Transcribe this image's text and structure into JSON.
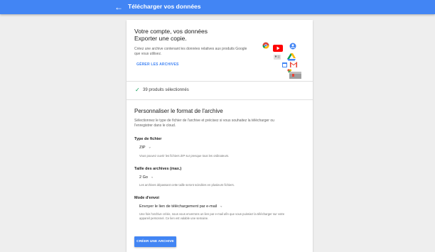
{
  "header": {
    "title": "Télécharger vos données",
    "back_icon": "arrow-back-icon"
  },
  "intro": {
    "heading_line1": "Votre compte, vos données",
    "heading_line2": "Exporter une copie.",
    "description": "Créez une archive contenant les données relatives aux produits Google que vous utilisez.",
    "manage_link": "GÉRER LES ARCHIVES"
  },
  "products": {
    "selected_text": "39 produits sélectionnés",
    "icon": "check-icon"
  },
  "customize": {
    "title": "Personnaliser le format de l'archive",
    "description": "Sélectionnez le type de fichier de l'archive et précisez si vous souhaitez la télécharger ou l'enregistrer dans le cloud.",
    "file_type": {
      "label": "Type de fichier",
      "value": "ZIP",
      "hint": "Vous pouvez ouvrir les fichiers ZIP sur presque tous les ordinateurs."
    },
    "archive_size": {
      "label": "Taille des archives (max.)",
      "value": "2 Go",
      "hint": "Les archives dépassant cette taille seront scindées en plusieurs fichiers."
    },
    "delivery": {
      "label": "Mode d'envoi",
      "value": "Envoyer le lien de téléchargement par e-mail",
      "hint": "Une fois l'archive créée, nous vous enverrons un lien par e-mail afin que vous puissiez la télécharger sur votre appareil personnel. Ce lien est valable une semaine."
    },
    "create_button": "CRÉER UNE ARCHIVE"
  },
  "colors": {
    "primary": "#4285f4",
    "check": "#0f9d58",
    "youtube": "#ff0000",
    "gmail": "#ea4335",
    "drive_green": "#34a853",
    "drive_yellow": "#fbbc05"
  }
}
